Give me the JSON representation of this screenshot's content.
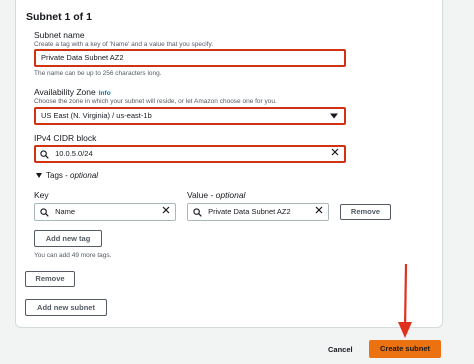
{
  "section": {
    "title": "Subnet 1 of 1"
  },
  "subnet_name": {
    "label": "Subnet name",
    "description": "Create a tag with a key of 'Name' and a value that you specify.",
    "value": "Private Data Subnet AZ2",
    "hint": "The name can be up to 256 characters long."
  },
  "availability_zone": {
    "label": "Availability Zone",
    "info": "Info",
    "description": "Choose the zone in which your subnet will reside, or let Amazon choose one for you.",
    "value": "US East (N. Virginia) / us-east-1b"
  },
  "cidr": {
    "label": "IPv4 CIDR block",
    "value": "10.0.5.0/24"
  },
  "tags": {
    "toggle_label": "Tags",
    "optional": "optional",
    "key_header": "Key",
    "value_header": "Value",
    "value_optional": "optional",
    "key": "Name",
    "value": "Private Data Subnet AZ2",
    "remove_label": "Remove",
    "add_label": "Add new tag",
    "more_hint": "You can add 49 more tags."
  },
  "subnet_actions": {
    "remove_label": "Remove",
    "add_label": "Add new subnet"
  },
  "footer": {
    "cancel_label": "Cancel",
    "create_label": "Create subnet"
  },
  "colors": {
    "highlight": "#d13212",
    "primary": "#ec7211",
    "arrow": "#e0301e",
    "info_link": "#0073bb"
  }
}
